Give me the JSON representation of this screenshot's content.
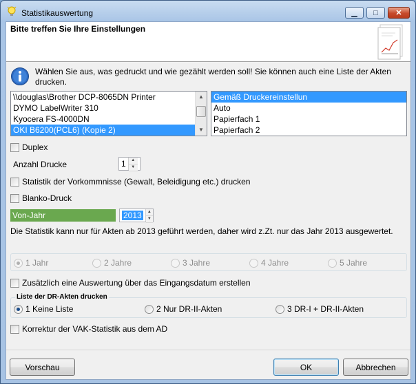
{
  "window": {
    "title": "Statistikauswertung",
    "min": "▁",
    "max": "□",
    "close": "✕"
  },
  "header": {
    "title": "Bitte treffen Sie Ihre Einstellungen"
  },
  "info": {
    "text": "Wählen Sie aus, was gedruckt und wie gezählt werden soll! Sie können auch eine Liste der Akten drucken."
  },
  "printers": {
    "items": [
      "\\\\douglas\\Brother DCP-8065DN Printer",
      "DYMO LabelWriter 310",
      "Kyocera FS-4000DN",
      "OKI B6200(PCL6) (Kopie 2)"
    ],
    "selected": 3
  },
  "trays": {
    "items": [
      "Gemäß Druckereinstellun",
      "Auto",
      "Papierfach 1",
      "Papierfach 2"
    ],
    "selected": 0
  },
  "options": {
    "duplex": "Duplex",
    "anzahl_label": "Anzahl Drucke",
    "anzahl_value": "1",
    "statistik_vorkommnisse": "Statistik der Vorkommnisse (Gewalt, Beleidigung etc.) drucken",
    "blanko": "Blanko-Druck",
    "von_jahr_label": "Von-Jahr",
    "von_jahr_value": "2013",
    "note": "Die Statistik kann nur für Akten ab 2013 geführt werden, daher wird z.Zt. nur das Jahr 2013 ausgewertet.",
    "jahre": [
      "1 Jahr",
      "2 Jahre",
      "3 Jahre",
      "4 Jahre",
      "5 Jahre"
    ],
    "eingangsdatum": "Zusätzlich eine Auswertung über das Eingangsdatum erstellen",
    "dr_group_label": "Liste der DR-Akten drucken",
    "dr_options": [
      "1 Keine Liste",
      "2 Nur DR-II-Akten",
      "3 DR-I + DR-II-Akten"
    ],
    "korrektur": "Korrektur der VAK-Statistik aus dem AD"
  },
  "buttons": {
    "vorschau": "Vorschau",
    "ok": "OK",
    "abbrechen": "Abbrechen"
  },
  "icons": [
    "lightbulb-icon",
    "info-icon",
    "document-chart-icon"
  ]
}
